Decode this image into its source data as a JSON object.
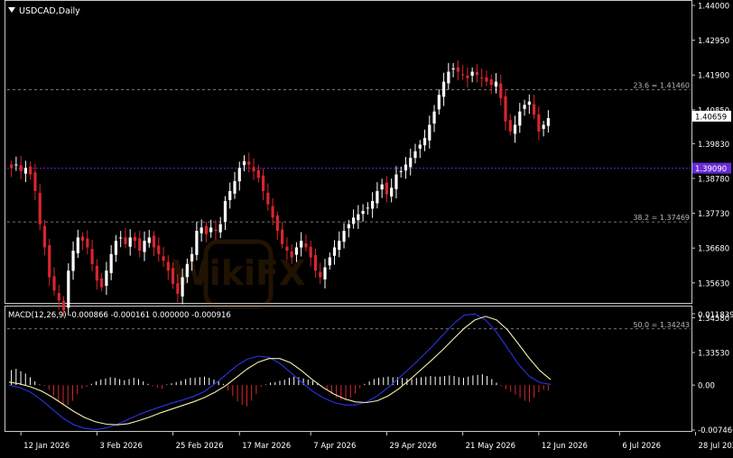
{
  "window": {
    "symbol_title": "USDCAD,Daily",
    "indicator_title": "MACD(12,26,9) -0.000866 -0.000161 0.000000 -0.000916",
    "watermark": "WikiFX"
  },
  "colors": {
    "background": "#000000",
    "axis": "#c8c8c8",
    "grid": "#9a9a9a",
    "bull_candle": "#ffffff",
    "bear_candle": "#d8262c",
    "price_line": "#6a2ad8",
    "macd_line": "#2a34e6",
    "signal_line": "#f2f0b4",
    "hist_pos": "#ffffff",
    "hist_neg": "#d8262c"
  },
  "price_axis": {
    "ticks": [
      "1.44000",
      "1.42950",
      "1.41900",
      "1.40850",
      "1.39830",
      "1.38780",
      "1.37730",
      "1.36680",
      "1.35630",
      "1.34580",
      "1.33530"
    ],
    "tick_values": [
      1.44,
      1.4295,
      1.419,
      1.4085,
      1.3983,
      1.3878,
      1.3773,
      1.3668,
      1.3563,
      1.3458,
      1.3353
    ],
    "current_price_label": "1.40659",
    "current_price": 1.40659,
    "level_label": "1.39090",
    "level": 1.3909
  },
  "fibonacci": [
    {
      "label": "23.6 = 1.41460",
      "value": 1.4146
    },
    {
      "label": "38.2 = 1.37469",
      "value": 1.37469
    },
    {
      "label": "50.0 = 1.34243",
      "value": 1.34243
    }
  ],
  "macd_axis": {
    "ticks": [
      "0.011839",
      "0.00",
      "-0.007466"
    ],
    "tick_values": [
      0.011839,
      0.0,
      -0.007466
    ]
  },
  "time_axis": {
    "labels": [
      "12 Jan 2026",
      "3 Feb 2026",
      "25 Feb 2026",
      "17 Mar 2026",
      "7 Apr 2026",
      "29 Apr 2026",
      "21 May 2026",
      "12 Jun 2026",
      "6 Jul 2026",
      "28 Jul 2026"
    ],
    "label_bar_index": [
      2,
      18,
      34,
      48,
      63,
      79,
      95,
      111,
      128,
      144
    ]
  },
  "chart_data": {
    "type": "candlestick",
    "symbol": "USDCAD",
    "timeframe": "Daily",
    "ylim": [
      1.3353,
      1.44
    ],
    "closes": [
      1.391,
      1.392,
      1.39,
      1.391,
      1.389,
      1.384,
      1.374,
      1.367,
      1.358,
      1.354,
      1.351,
      1.348,
      1.36,
      1.366,
      1.37,
      1.369,
      1.367,
      1.362,
      1.357,
      1.355,
      1.36,
      1.365,
      1.369,
      1.37,
      1.368,
      1.37,
      1.369,
      1.366,
      1.369,
      1.37,
      1.367,
      1.365,
      1.363,
      1.36,
      1.356,
      1.353,
      1.358,
      1.362,
      1.365,
      1.372,
      1.373,
      1.371,
      1.373,
      1.372,
      1.374,
      1.381,
      1.384,
      1.387,
      1.391,
      1.393,
      1.392,
      1.39,
      1.388,
      1.384,
      1.38,
      1.376,
      1.372,
      1.368,
      1.366,
      1.364,
      1.367,
      1.369,
      1.367,
      1.364,
      1.36,
      1.358,
      1.361,
      1.364,
      1.367,
      1.369,
      1.372,
      1.374,
      1.376,
      1.377,
      1.378,
      1.379,
      1.381,
      1.384,
      1.386,
      1.383,
      1.385,
      1.389,
      1.39,
      1.392,
      1.394,
      1.396,
      1.398,
      1.4,
      1.404,
      1.408,
      1.413,
      1.417,
      1.42,
      1.421,
      1.42,
      1.419,
      1.418,
      1.42,
      1.419,
      1.418,
      1.417,
      1.416,
      1.417,
      1.412,
      1.405,
      1.402,
      1.404,
      1.408,
      1.41,
      1.411,
      1.407,
      1.402,
      1.404,
      1.406
    ],
    "macd": {
      "ylim": [
        -0.007466,
        0.011839
      ],
      "macd_line": [
        0.0,
        -0.0004,
        -0.0012,
        -0.0025,
        -0.004,
        -0.0055,
        -0.0066,
        -0.0072,
        -0.0074,
        -0.0071,
        -0.0065,
        -0.0057,
        -0.0049,
        -0.0042,
        -0.0036,
        -0.003,
        -0.0025,
        -0.0019,
        -0.0011,
        0.0002,
        0.0017,
        0.0032,
        0.0043,
        0.0048,
        0.0046,
        0.0036,
        0.0021,
        0.0005,
        -0.001,
        -0.0021,
        -0.0029,
        -0.0033,
        -0.0033,
        -0.0028,
        -0.0018,
        -0.0004,
        0.0012,
        0.0028,
        0.0045,
        0.0063,
        0.0082,
        0.0101,
        0.0116,
        0.0118,
        0.0108,
        0.0088,
        0.0062,
        0.0035,
        0.0015,
        0.0004,
        0.0001
      ],
      "signal_line": [
        0.0005,
        0.0002,
        -0.0003,
        -0.001,
        -0.002,
        -0.0032,
        -0.0044,
        -0.0054,
        -0.0061,
        -0.0065,
        -0.0066,
        -0.0064,
        -0.0059,
        -0.0053,
        -0.0046,
        -0.004,
        -0.0034,
        -0.0028,
        -0.0021,
        -0.0012,
        -0.0001,
        0.0013,
        0.0027,
        0.0038,
        0.0044,
        0.0044,
        0.0037,
        0.0024,
        0.0009,
        -0.0004,
        -0.0015,
        -0.0023,
        -0.0028,
        -0.0029,
        -0.0026,
        -0.0018,
        -0.0006,
        0.0009,
        0.0025,
        0.0041,
        0.0058,
        0.0076,
        0.0094,
        0.0108,
        0.0114,
        0.0108,
        0.0092,
        0.0069,
        0.0045,
        0.0024,
        0.0009
      ],
      "histogram": [
        0.0025,
        0.0027,
        0.0023,
        0.0019,
        0.0013,
        0.0006,
        0.0001,
        -0.0002,
        -0.0008,
        -0.0017,
        -0.0026,
        -0.0032,
        -0.0033,
        -0.0026,
        -0.0015,
        -0.0006,
        -0.0003,
        0.0002,
        0.0006,
        0.0009,
        0.0011,
        0.0013,
        0.0012,
        0.001,
        0.0008,
        0.001,
        0.0012,
        0.001,
        0.0006,
        0.0002,
        -0.0002,
        -0.0005,
        -0.0006,
        0.0001,
        0.0003,
        0.0005,
        0.0007,
        0.001,
        0.0012,
        0.0012,
        0.0013,
        0.0014,
        0.0012,
        0.0009,
        0.0006,
        0.0002,
        -0.0009,
        -0.0018,
        -0.0027,
        -0.0033,
        -0.0035,
        -0.0026,
        -0.0015,
        -0.0003,
        0.0001,
        0.0004,
        0.0005,
        0.0007,
        0.0009,
        0.0012,
        0.0014,
        0.0013,
        0.0011,
        0.0009,
        0.0007,
        0.0003,
        -0.0001,
        -0.0008,
        -0.0015,
        -0.0021,
        -0.0025,
        -0.0026,
        -0.0021,
        -0.0014,
        -0.0005,
        0.0002,
        0.0006,
        0.001,
        0.0012,
        0.0013,
        0.0014,
        0.0013,
        0.0013,
        0.0012,
        0.0011,
        0.001,
        0.0012,
        0.0013,
        0.0014,
        0.0015,
        0.0014,
        0.0014,
        0.0015,
        0.0016,
        0.0015,
        0.0013,
        0.0012,
        0.0014,
        0.0016,
        0.0017,
        0.0018,
        0.0015,
        0.001,
        0.0004,
        -0.0002,
        -0.0007,
        -0.0011,
        -0.0016,
        -0.0021,
        -0.0026,
        -0.0028,
        -0.0021,
        -0.0012,
        -0.0008,
        -0.0009
      ]
    }
  }
}
